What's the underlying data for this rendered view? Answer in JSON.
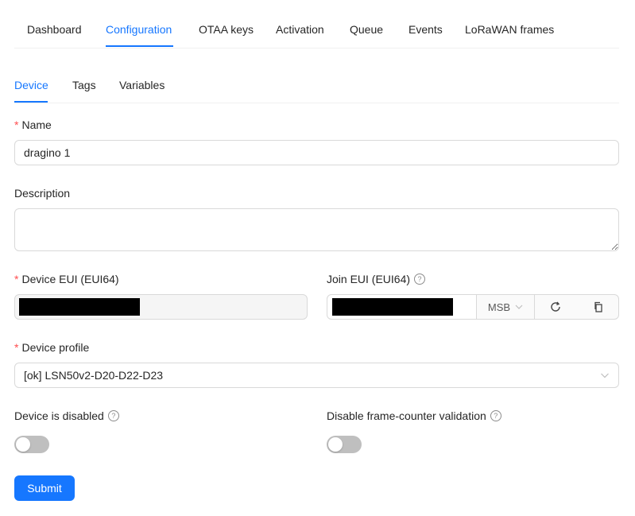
{
  "top_tabs": [
    {
      "label": "Dashboard"
    },
    {
      "label": "Configuration"
    },
    {
      "label": "OTAA keys"
    },
    {
      "label": "Activation"
    },
    {
      "label": "Queue"
    },
    {
      "label": "Events"
    },
    {
      "label": "LoRaWAN frames"
    }
  ],
  "sub_tabs": [
    {
      "label": "Device"
    },
    {
      "label": "Tags"
    },
    {
      "label": "Variables"
    }
  ],
  "form": {
    "name": {
      "label": "Name",
      "value": "dragino 1"
    },
    "description": {
      "label": "Description",
      "value": ""
    },
    "device_eui": {
      "label": "Device EUI (EUI64)"
    },
    "join_eui": {
      "label": "Join EUI (EUI64)",
      "byte_order": "MSB"
    },
    "device_profile": {
      "label": "Device profile",
      "value": "[ok] LSN50v2-D20-D22-D23"
    },
    "device_disabled": {
      "label": "Device is disabled"
    },
    "disable_fcnt": {
      "label": "Disable frame-counter validation"
    },
    "submit_label": "Submit"
  },
  "colors": {
    "accent": "#1677ff",
    "required": "#ff4d4f"
  }
}
